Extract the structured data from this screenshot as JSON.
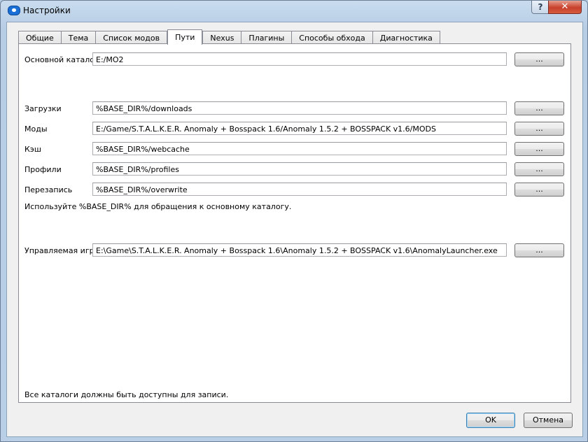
{
  "window": {
    "title": "Настройки",
    "help_label": "?",
    "close_label": "✕"
  },
  "tabs": [
    {
      "label": "Общие"
    },
    {
      "label": "Тема"
    },
    {
      "label": "Список модов"
    },
    {
      "label": "Пути",
      "active": true
    },
    {
      "label": "Nexus"
    },
    {
      "label": "Плагины"
    },
    {
      "label": "Способы обхода"
    },
    {
      "label": "Диагностика"
    }
  ],
  "paths": {
    "base_dir": {
      "label": "Основной каталог",
      "value": "E:/MO2"
    },
    "downloads": {
      "label": "Загрузки",
      "value": "%BASE_DIR%/downloads"
    },
    "mods": {
      "label": "Моды",
      "value": "E:/Game/S.T.A.L.K.E.R. Anomaly + Bosspack 1.6/Anomaly 1.5.2 + BOSSPACK v1.6/MODS"
    },
    "cache": {
      "label": "Кэш",
      "value": "%BASE_DIR%/webcache"
    },
    "profiles": {
      "label": "Профили",
      "value": "%BASE_DIR%/profiles"
    },
    "overwrite": {
      "label": "Перезапись",
      "value": "%BASE_DIR%/overwrite"
    },
    "base_dir_hint": "Используйте %BASE_DIR% для обращения к основному каталогу.",
    "managed_game": {
      "label": "Управляемая игра",
      "value": "E:\\Game\\S.T.A.L.K.E.R. Anomaly + Bosspack 1.6\\Anomaly 1.5.2 + BOSSPACK v1.6\\AnomalyLauncher.exe"
    },
    "browse_label": "...",
    "writable_note": "Все каталоги должны быть доступны для записи."
  },
  "buttons": {
    "ok": "OK",
    "cancel": "Отмена"
  }
}
